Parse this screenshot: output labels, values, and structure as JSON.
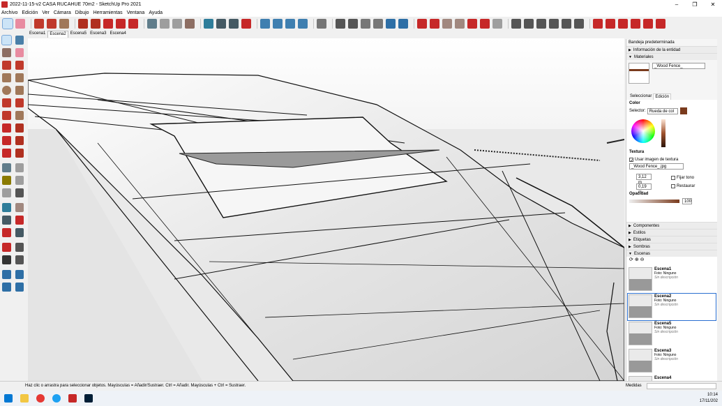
{
  "window": {
    "title": "2022-11-15-v2 CASA RUCAHUE 70m2 - SketchUp Pro 2021",
    "controls": [
      "–",
      "❐",
      "✕"
    ]
  },
  "menu": [
    "Archivo",
    "Edición",
    "Ver",
    "Cámara",
    "Dibujo",
    "Herramientas",
    "Ventana",
    "Ayuda"
  ],
  "scene_tabs": [
    "Escena1",
    "Escena2",
    "Escena5",
    "Escena3",
    "Escena4"
  ],
  "active_scene_tab": "Escena2",
  "tray": {
    "title": "Bandeja predeterminada",
    "entity_info": "Información de la entidad",
    "materials": {
      "header": "Materiales",
      "material_name": "_Wood Fence_",
      "tabs": [
        "Seleccionar",
        "Edición"
      ],
      "color_label": "Color",
      "selector_label": "Selector:",
      "selector_value": "Rueda de col",
      "texture_label": "Textura",
      "use_texture": "Usar imagen de textura",
      "texture_file": "_Wood Fence_.jpg",
      "width": "3,12 m",
      "height": "0,19 m",
      "fix_tone": "Fijar tono",
      "reset": "Restaurar",
      "opacity_label": "Opacidad",
      "opacity_value": "100",
      "swatch_color": "#7a3b1d"
    },
    "collapsed_panels": [
      "Componentes",
      "Estilos",
      "Etiquetas",
      "Sombras"
    ],
    "scenes": {
      "header": "Escenas",
      "items": [
        {
          "name": "Escena1",
          "photo": "Foto: Ninguno",
          "desc": "Sin descripción"
        },
        {
          "name": "Escena2",
          "photo": "Foto: Ninguno",
          "desc": "Sin descripción"
        },
        {
          "name": "Escena5",
          "photo": "Foto: Ninguno",
          "desc": "Sin descripción"
        },
        {
          "name": "Escena3",
          "photo": "Foto: Ninguno",
          "desc": "Sin descripción"
        },
        {
          "name": "Escena4",
          "photo": "",
          "desc": ""
        }
      ],
      "selected": "Escena2"
    }
  },
  "status": {
    "message": "Haz clic o arrastra para seleccionar objetos. Mayúsculas = Añadir/Sustraer. Ctrl = Añadir. Mayúsculas + Ctrl = Sustraer.",
    "measures_label": "Medidas"
  },
  "taskbar": {
    "time": "10:14",
    "date": "17/11/202"
  }
}
